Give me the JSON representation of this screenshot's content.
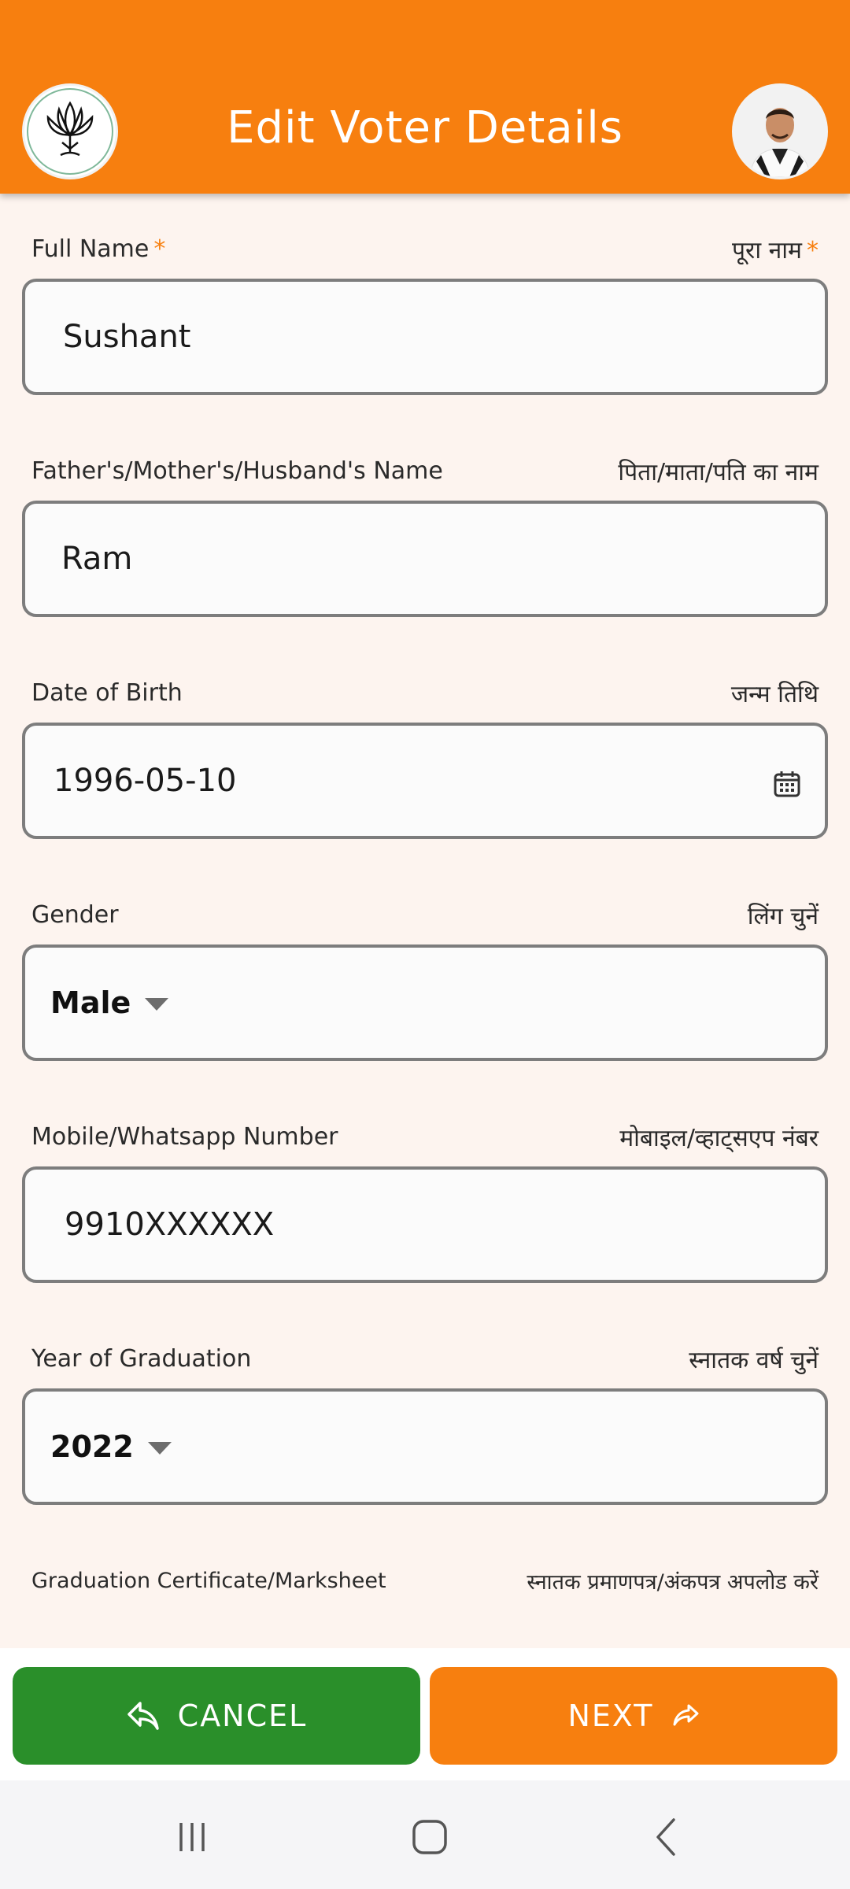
{
  "header": {
    "title": "Edit Voter Details"
  },
  "fields": {
    "full_name": {
      "label_en": "Full Name",
      "label_hi": "पूरा नाम",
      "required_mark": "*",
      "value": "Sushant"
    },
    "relative_name": {
      "label_en": "Father's/Mother's/Husband's Name",
      "label_hi": "पिता/माता/पति का नाम",
      "value": "Ram"
    },
    "dob": {
      "label_en": "Date of Birth",
      "label_hi": "जन्म तिथि",
      "value": "1996-05-10",
      "icon": "calendar-icon"
    },
    "gender": {
      "label_en": "Gender",
      "label_hi": "लिंग चुनें",
      "value": "Male"
    },
    "mobile": {
      "label_en": "Mobile/Whatsapp Number",
      "label_hi": "मोबाइल/व्हाट्सएप नंबर",
      "value": "9910XXXXXX"
    },
    "grad_year": {
      "label_en": "Year of Graduation",
      "label_hi": "स्नातक वर्ष चुनें",
      "value": "2022"
    },
    "certificate": {
      "label_en": "Graduation Certificate/Marksheet",
      "label_hi": "स्नातक प्रमाणपत्र/अंकपत्र अपलोड करें"
    }
  },
  "buttons": {
    "cancel": "CANCEL",
    "next": "NEXT"
  },
  "colors": {
    "accent": "#f77f0f",
    "cancel": "#2a8f2a",
    "background": "#fdf4ef"
  }
}
